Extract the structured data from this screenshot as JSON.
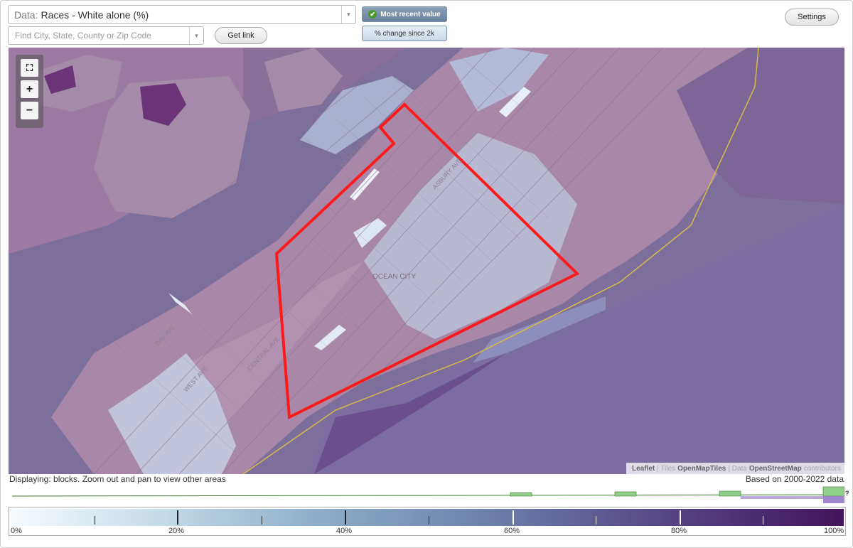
{
  "header": {
    "data_prefix": "Data:",
    "data_value": "Races - White alone (%)",
    "search_placeholder": "Find City, State, County or Zip Code",
    "get_link_label": "Get link",
    "mode_recent_label": "Most recent value",
    "mode_change_label": "% change since 2k",
    "settings_label": "Settings"
  },
  "map": {
    "place_label": "OCEAN CITY",
    "street_labels": [
      "ASBURY AVE",
      "CENTRAL AVE",
      "WEST AVE",
      "BAY AVE",
      "WESLEY AVE"
    ],
    "boundary_color": "#ff1a1a",
    "attribution": {
      "leaflet": "Leaflet",
      "tiles_prefix": "| Tiles",
      "tiles": "OpenMapTiles",
      "data_prefix": "| Data",
      "data": "OpenStreetMap",
      "contributors": "contributors"
    }
  },
  "zoom": {
    "fullscreen": "⛶",
    "zoom_in": "+",
    "zoom_out": "−"
  },
  "status": {
    "displaying": "Displaying: blocks. Zoom out and pan to view other areas",
    "based_on": "Based on 2000-2022 data",
    "help": "?"
  },
  "legend": {
    "labels": [
      "0%",
      "20%",
      "40%",
      "60%",
      "80%",
      "100%"
    ],
    "colors": [
      "#f7fbfe",
      "#8fb0cb",
      "#6f86ae",
      "#5a4f8c",
      "#44145c"
    ]
  }
}
